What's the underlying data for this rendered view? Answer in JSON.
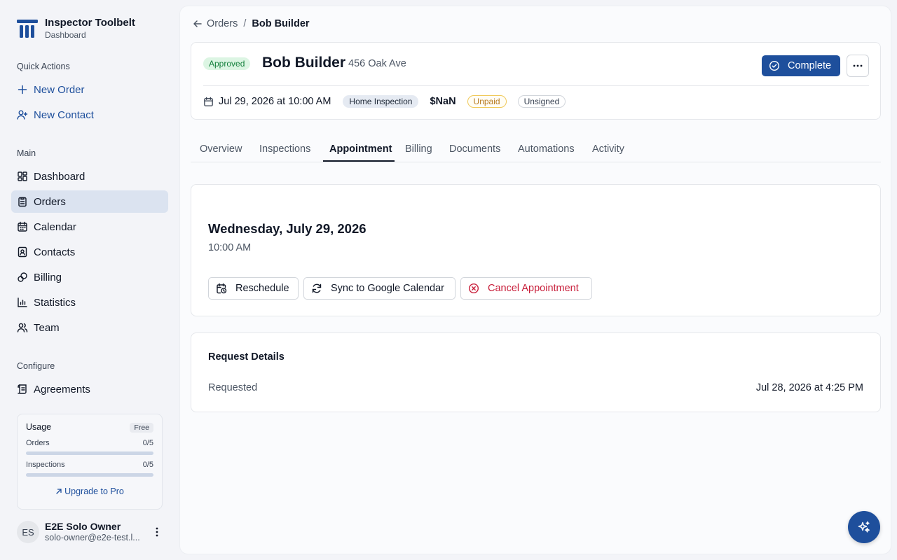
{
  "app": {
    "name": "Inspector Toolbelt",
    "subtitle": "Dashboard"
  },
  "sidebar": {
    "quick_actions_label": "Quick Actions",
    "quick_actions": [
      {
        "label": "New Order",
        "icon": "plus-icon"
      },
      {
        "label": "New Contact",
        "icon": "user-plus-icon"
      }
    ],
    "main_label": "Main",
    "main_items": [
      {
        "label": "Dashboard",
        "icon": "dashboard-icon"
      },
      {
        "label": "Orders",
        "icon": "clipboard-icon",
        "active": true
      },
      {
        "label": "Calendar",
        "icon": "calendar-icon"
      },
      {
        "label": "Contacts",
        "icon": "contact-card-icon"
      },
      {
        "label": "Billing",
        "icon": "billing-icon"
      },
      {
        "label": "Statistics",
        "icon": "bar-chart-icon"
      },
      {
        "label": "Team",
        "icon": "users-icon"
      }
    ],
    "configure_label": "Configure",
    "configure_items": [
      {
        "label": "Agreements",
        "icon": "scroll-icon"
      }
    ],
    "usage": {
      "title": "Usage",
      "plan": "Free",
      "orders_label": "Orders",
      "orders_value": "0/5",
      "orders_fraction": 0,
      "inspections_label": "Inspections",
      "inspections_value": "0/5",
      "inspections_fraction": 0,
      "upgrade_label": "Upgrade to Pro"
    },
    "user": {
      "initials": "ES",
      "name": "E2E Solo Owner",
      "email": "solo-owner@e2e-test.l..."
    }
  },
  "breadcrumb": {
    "parent": "Orders",
    "separator": "/",
    "current": "Bob Builder"
  },
  "order": {
    "status": "Approved",
    "name": "Bob Builder",
    "address": "456 Oak Ave",
    "complete_label": "Complete",
    "date": "Jul 29, 2026 at 10:00 AM",
    "type": "Home Inspection",
    "price": "$NaN",
    "payment_status": "Unpaid",
    "signature_status": "Unsigned"
  },
  "tabs": [
    "Overview",
    "Inspections",
    "Appointment",
    "Billing",
    "Documents",
    "Automations",
    "Activity"
  ],
  "active_tab": "Appointment",
  "appointment": {
    "date": "Wednesday, July 29, 2026",
    "time": "10:00 AM",
    "reschedule_label": "Reschedule",
    "sync_label": "Sync to Google Calendar",
    "cancel_label": "Cancel Appointment"
  },
  "request_details": {
    "title": "Request Details",
    "requested_label": "Requested",
    "requested_value": "Jul 28, 2026 at 4:25 PM"
  },
  "colors": {
    "primary": "#1e4f9c",
    "approved": "#15803d",
    "unpaid": "#b7791f",
    "danger": "#c81e3a"
  }
}
